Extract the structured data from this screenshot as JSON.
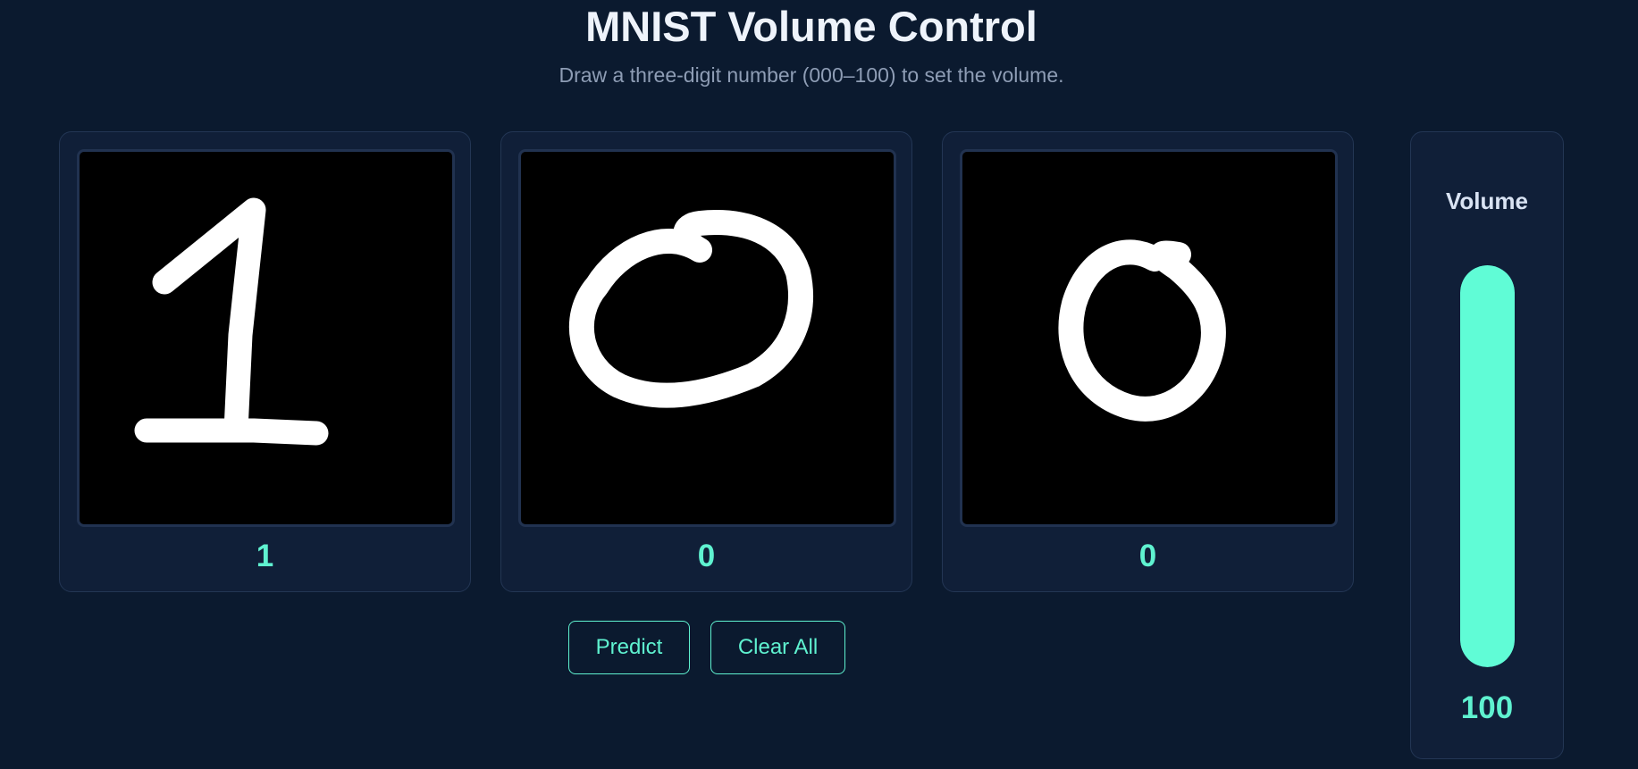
{
  "header": {
    "title": "MNIST Volume Control",
    "subtitle": "Draw a three-digit number (000–100) to set the volume."
  },
  "digits": [
    {
      "drawn": "1",
      "prediction": "1"
    },
    {
      "drawn": "0",
      "prediction": "0"
    },
    {
      "drawn": "0",
      "prediction": "0"
    }
  ],
  "buttons": {
    "predict_label": "Predict",
    "clear_label": "Clear All"
  },
  "volume": {
    "label": "Volume",
    "value": "100",
    "level_percent": 100
  },
  "colors": {
    "background": "#0b1a2f",
    "panel": "#101f38",
    "accent": "#5ff2d0",
    "canvas": "#000000",
    "stroke": "#ffffff"
  }
}
